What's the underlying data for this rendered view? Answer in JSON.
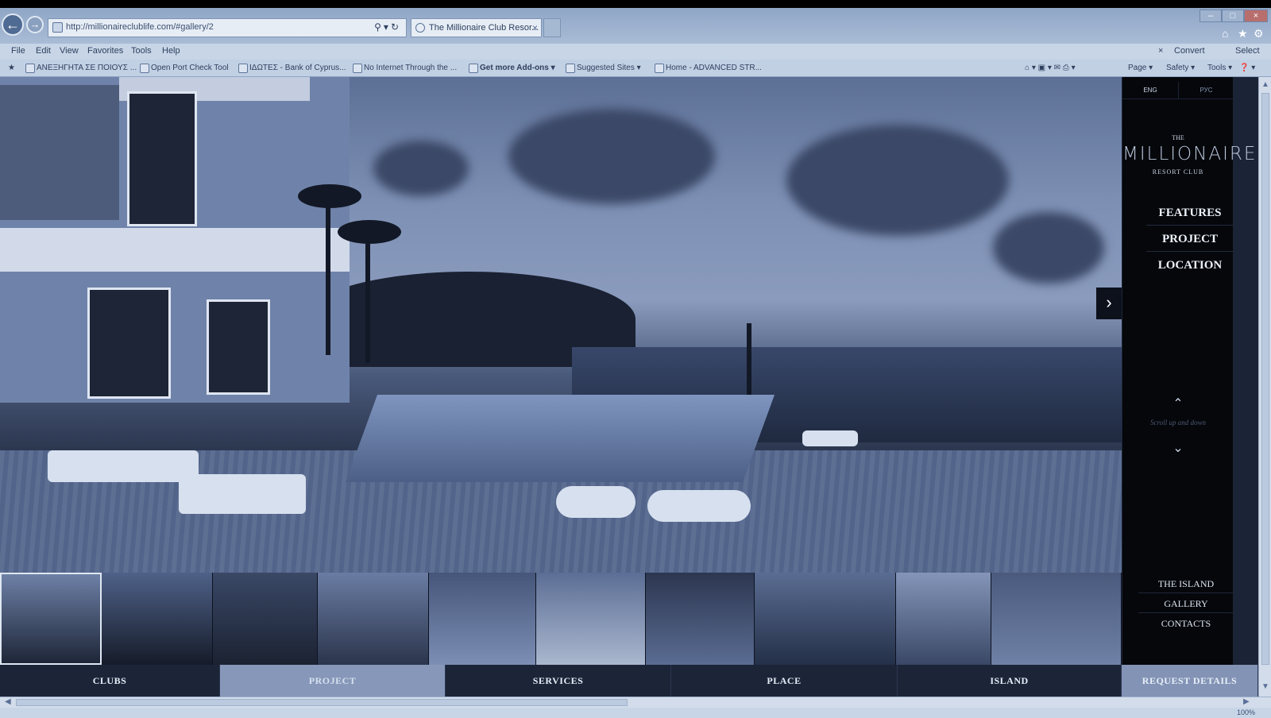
{
  "browser": {
    "url": "http://millionaireclublife.com/#gallery/2",
    "tab_title": "The Millionaire Club Resor...",
    "menu": [
      "File",
      "Edit",
      "View",
      "Favorites",
      "Tools",
      "Help"
    ],
    "convert_label": "Convert",
    "select_label": "Select",
    "favorites": [
      {
        "label": "ΑΝΕΞΗΓΗΤΑ ΣΕ ΠΟΙΟΥΣ ...",
        "bold": false
      },
      {
        "label": "Open Port Check Tool",
        "bold": false
      },
      {
        "label": "ΙΔΩΤΕΣ - Bank of Cyprus...",
        "bold": false
      },
      {
        "label": "No Internet Through the ...",
        "bold": false
      },
      {
        "label": "Get more Add-ons ▾",
        "bold": true
      },
      {
        "label": "Suggested Sites ▾",
        "bold": false
      },
      {
        "label": "Home - ADVANCED STR...",
        "bold": false
      }
    ],
    "command_bar": [
      "Page ▾",
      "Safety ▾",
      "Tools ▾"
    ],
    "zoom": "100%"
  },
  "site": {
    "lang": {
      "en": "ENG",
      "ru": "РУС"
    },
    "logo": {
      "the": "THE",
      "main": "MILLIONAIRE",
      "sub": "RESORT CLUB"
    },
    "side_menu": [
      "FEATURES",
      "PROJECT",
      "LOCATION"
    ],
    "scroll_hint": "Scroll up and down",
    "bottom_menu": [
      "THE ISLAND",
      "GALLERY",
      "CONTACTS"
    ],
    "nav": [
      "CLUBS",
      "PROJECT",
      "SERVICES",
      "PLACE",
      "ISLAND"
    ],
    "active_nav": "PROJECT",
    "request_label": "REQUEST DETAILS",
    "thumbnail_count": 10
  }
}
